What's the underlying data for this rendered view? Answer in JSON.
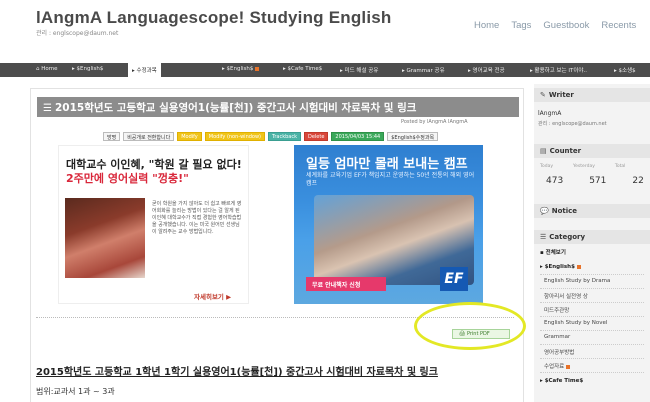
{
  "header": {
    "title": "lAngmA Languagescope! Studying English",
    "subtitle": "관리 : englscope@daum.net",
    "nav": [
      "Home",
      "Tags",
      "Guestbook",
      "Recents"
    ]
  },
  "menubar": {
    "items": [
      "Home",
      "$English$",
      "수정과목",
      "$English$",
      "$Cafe Time$",
      "미드 해설 공유",
      "Grammar 공유",
      "영어교육 전공",
      "활용하고 보는 IT이야..",
      "$소생$"
    ]
  },
  "post": {
    "title": "2015학년도 고등학교 실용영어1(능률[천]) 중간고사 시험대비 자료목차 및 링크",
    "meta": "Posted by lAngmA lAngmA",
    "buttons": [
      "방명",
      "비공개로 전환합니다",
      "Modify",
      "Modify (non-window)",
      "Trackback",
      "Delete",
      "2015/04/03 15:44",
      "$English$수정과목"
    ],
    "print_label": "Print  PDF",
    "body_title": "2015학년도 고등학교 1학년 1학기 실용영어1(능률[천]) 중간고사 시험대비 자료목차 및 링크",
    "body_line": "범위:교과서 1과 ~ 3과"
  },
  "ad_left": {
    "headline_1": "대학교수 이인혜, \"학원 갈 필요 없다!",
    "headline_2": "2주만에 영어실력 \"껑충!\"",
    "body": "굳이 학원을 가지 않아도 더 쉽고 빠르게 영어회화를 늘리는 방법이 있다는 걸 알게 된 이인혜 대학교수가 직접 경험한 영어학습법을 공개했습니다. 이는 미국 원어민 선생님이 알려주는 교수 방법입니다.",
    "more": "자세히보기 ▶"
  },
  "ad_right": {
    "headline": "일등 엄마만 몰래 보내는 캠프",
    "sub": "세계화를 교육기업 EF가 책임지고 운영하는 50년 전통의 해외 영어캠프",
    "cta": "무료 안내책자 신청",
    "logo": "EF"
  },
  "sidebar": {
    "writer_title": "Writer",
    "writer_name": "lAngmA",
    "writer_mail": "관리 : englscope@daum.net",
    "counter_title": "Counter",
    "counter_labels": [
      "Today",
      "Yesterday",
      "Total"
    ],
    "counter_values": [
      "473",
      "571",
      "22"
    ],
    "notice_title": "Notice",
    "category_title": "Category",
    "categories": [
      "전체보기",
      "$English$",
      "English Study by Drama",
      "항아리서 실전영 상",
      "미드주관망",
      "English Study by Novel",
      "Grammar",
      "영어공부방법",
      "수업자료",
      "$Cafe Time$"
    ]
  }
}
